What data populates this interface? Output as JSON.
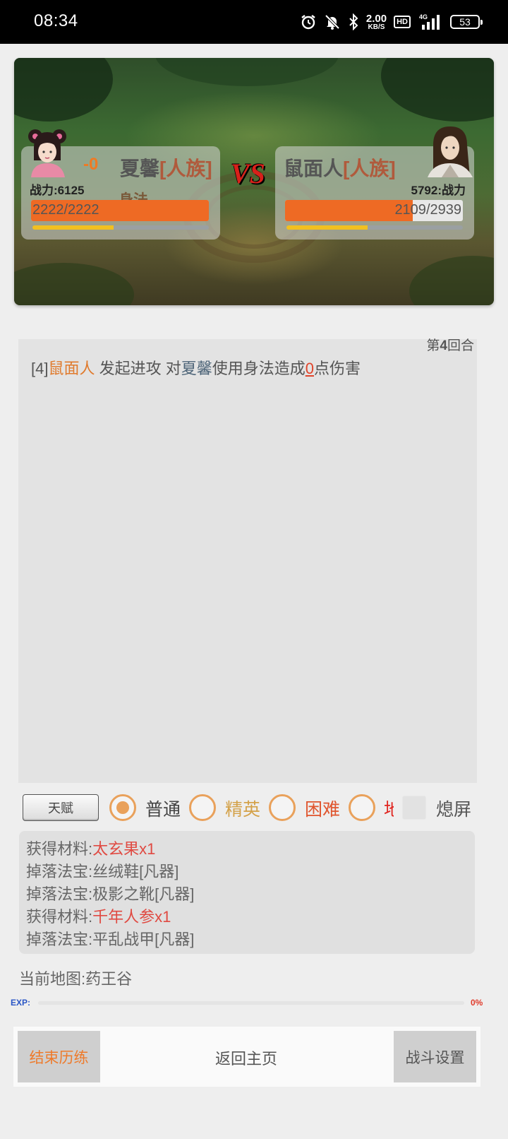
{
  "status_bar": {
    "time": "08:34",
    "net_speed_value": "2.00",
    "net_speed_unit": "KB/S",
    "hd_badge": "HD",
    "network": "4G",
    "battery": "53",
    "icons": [
      "alarm-icon",
      "mute-icon",
      "bluetooth-icon",
      "signal-icon",
      "battery-icon"
    ]
  },
  "battle": {
    "left": {
      "damage": "-0",
      "name": "夏馨",
      "race": "[人族]",
      "power_text": "战力:6125",
      "hp_text": "2222/2222",
      "hp_fraction": 1.0,
      "mp_fraction": 0.46,
      "skill_popup": "身法"
    },
    "right": {
      "name": "鼠面人",
      "race": "[人族]",
      "power_text": "5792:战力",
      "hp_current": "2109",
      "hp_sep_max": "/2939",
      "hp_fraction": 0.7176,
      "mp_fraction": 0.46
    },
    "vs_label": "VS"
  },
  "log": {
    "round_prefix": "第",
    "round_number": "4",
    "round_suffix": "回合",
    "line": {
      "index": "[4]",
      "attacker": "鼠面人",
      "mid": " 发起进攻 对",
      "target": "夏馨",
      "action": "使用身法造成",
      "damage": "0",
      "suffix": "点伤害"
    }
  },
  "controls": {
    "talent_button": "天赋",
    "difficulties": [
      {
        "label": "普通",
        "checked": true,
        "color": "#444444"
      },
      {
        "label": "精英",
        "checked": false,
        "color": "#d4a24a"
      },
      {
        "label": "困难",
        "checked": false,
        "color": "#e0552e"
      },
      {
        "label": "地",
        "checked": false,
        "color": "#e0241e"
      }
    ],
    "screen_off_label": "熄屏"
  },
  "loot": [
    {
      "prefix": "获得材料:",
      "item": "太玄果x1",
      "highlight": true
    },
    {
      "prefix": "掉落法宝:",
      "item": "丝绒鞋[凡器]",
      "highlight": false
    },
    {
      "prefix": "掉落法宝:",
      "item": "极影之靴[凡器]",
      "highlight": false
    },
    {
      "prefix": "获得材料:",
      "item": "千年人参x1",
      "highlight": true
    },
    {
      "prefix": "掉落法宝:",
      "item": "平乱战甲[凡器]",
      "highlight": false
    }
  ],
  "map": "当前地图:药王谷",
  "exp": {
    "label": "EXP:",
    "percent_text": "0%",
    "fraction": 0.0
  },
  "bottom_bar": {
    "end_training": "结束历练",
    "return_home": "返回主页",
    "battle_settings": "战斗设置"
  }
}
